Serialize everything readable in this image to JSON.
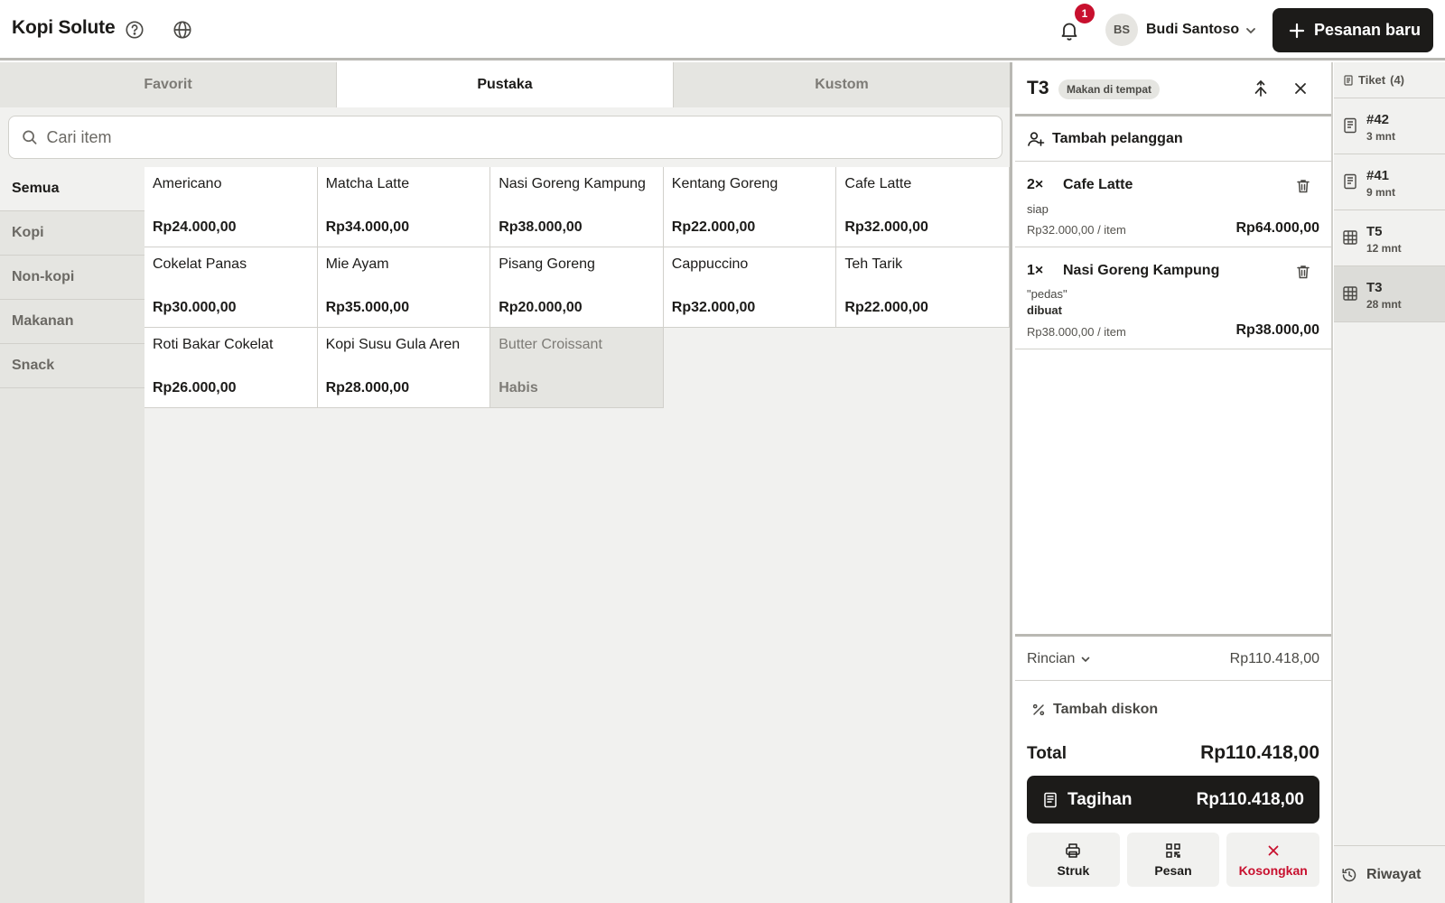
{
  "app": {
    "title": "Kopi Solute"
  },
  "header": {
    "notification_count": "1",
    "user": {
      "initials": "BS",
      "name": "Budi Santoso"
    },
    "new_order_label": "Pesanan baru"
  },
  "tabs": [
    {
      "label": "Favorit",
      "active": false
    },
    {
      "label": "Pustaka",
      "active": true
    },
    {
      "label": "Kustom",
      "active": false
    }
  ],
  "search": {
    "placeholder": "Cari item",
    "value": ""
  },
  "categories": [
    {
      "label": "Semua",
      "active": true
    },
    {
      "label": "Kopi",
      "active": false
    },
    {
      "label": "Non-kopi",
      "active": false
    },
    {
      "label": "Makanan",
      "active": false
    },
    {
      "label": "Snack",
      "active": false
    }
  ],
  "items": [
    {
      "name": "Americano",
      "price": "Rp24.000,00"
    },
    {
      "name": "Matcha Latte",
      "price": "Rp34.000,00"
    },
    {
      "name": "Nasi Goreng Kampung",
      "price": "Rp38.000,00"
    },
    {
      "name": "Kentang Goreng",
      "price": "Rp22.000,00"
    },
    {
      "name": "Cafe Latte",
      "price": "Rp32.000,00"
    },
    {
      "name": "Cokelat Panas",
      "price": "Rp30.000,00"
    },
    {
      "name": "Mie Ayam",
      "price": "Rp35.000,00"
    },
    {
      "name": "Pisang Goreng",
      "price": "Rp20.000,00"
    },
    {
      "name": "Cappuccino",
      "price": "Rp32.000,00"
    },
    {
      "name": "Teh Tarik",
      "price": "Rp22.000,00"
    },
    {
      "name": "Roti Bakar Cokelat",
      "price": "Rp26.000,00"
    },
    {
      "name": "Kopi Susu Gula Aren",
      "price": "Rp28.000,00"
    },
    {
      "name": "Butter Croissant",
      "price": "Habis",
      "sold_out": true
    }
  ],
  "order": {
    "table": "T3",
    "type": "Makan di tempat",
    "add_customer": "Tambah pelanggan",
    "lines": [
      {
        "qty": "2×",
        "name": "Cafe Latte",
        "note": "",
        "status": "siap",
        "unit_price": "Rp32.000,00 / item",
        "total": "Rp64.000,00"
      },
      {
        "qty": "1×",
        "name": "Nasi Goreng Kampung",
        "note": "\"pedas\"",
        "status": "dibuat",
        "unit_price": "Rp38.000,00 / item",
        "total": "Rp38.000,00"
      }
    ],
    "details_label": "Rincian",
    "details_amount": "Rp110.418,00",
    "discount_label": "Tambah diskon",
    "total_label": "Total",
    "total_amount": "Rp110.418,00",
    "charge_label": "Tagihan",
    "charge_amount": "Rp110.418,00",
    "actions": {
      "receipt": "Struk",
      "order": "Pesan",
      "clear": "Kosongkan"
    }
  },
  "tickets": {
    "header": "Tiket",
    "count": "(4)",
    "list": [
      {
        "name": "#42",
        "time": "3 mnt",
        "kind": "receipt",
        "active": false
      },
      {
        "name": "#41",
        "time": "9 mnt",
        "kind": "receipt",
        "active": false
      },
      {
        "name": "T5",
        "time": "12 mnt",
        "kind": "table",
        "active": false
      },
      {
        "name": "T3",
        "time": "28 mnt",
        "kind": "table",
        "active": true
      }
    ],
    "history_label": "Riwayat"
  },
  "colors": {
    "primary": "#1c1b19",
    "danger": "#c8102e",
    "surface": "#f1f1ef",
    "muted": "#e5e5e1"
  }
}
